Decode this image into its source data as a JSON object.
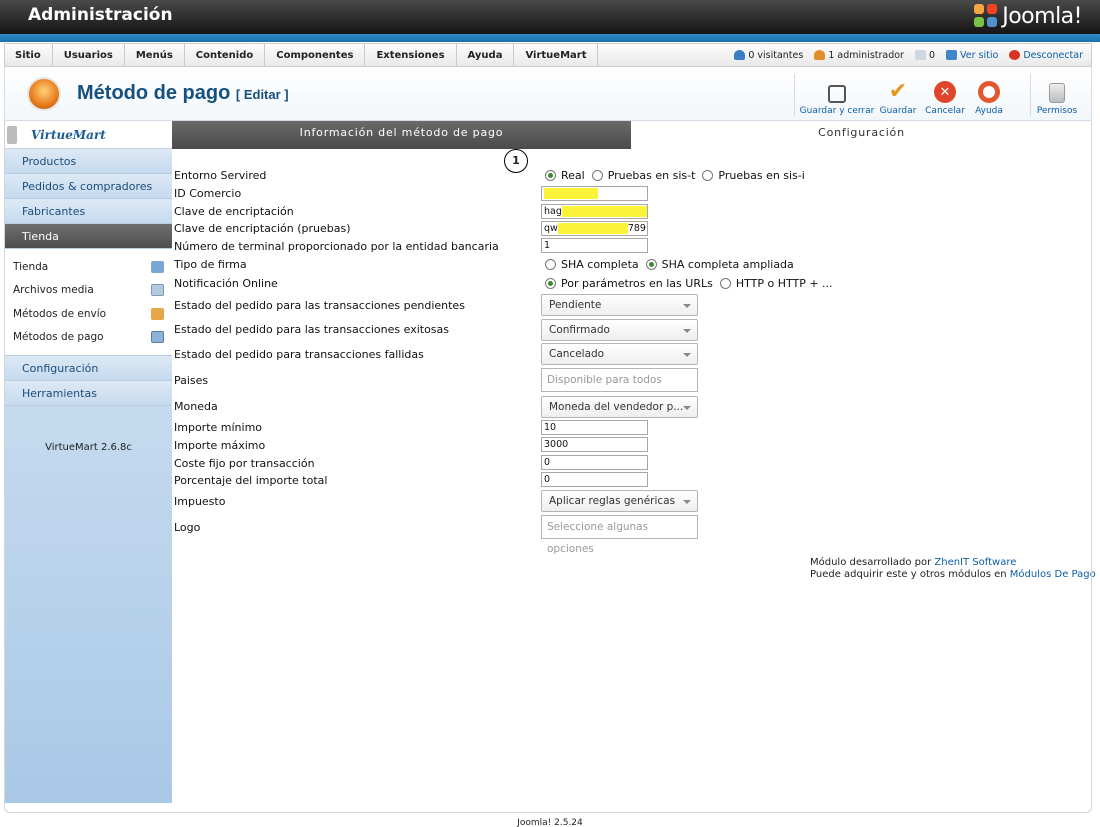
{
  "app": {
    "title": "Administración",
    "brand": "Joomla!"
  },
  "menu": {
    "items": [
      "Sitio",
      "Usuarios",
      "Menús",
      "Contenido",
      "Componentes",
      "Extensiones",
      "Ayuda",
      "VirtueMart"
    ],
    "status": {
      "visitors": "0 visitantes",
      "admins": "1 administrador",
      "messages": "0",
      "view_site": "Ver sitio",
      "logout": "Desconectar"
    }
  },
  "toolbar": {
    "heading": "Método de pago",
    "heading_suffix": "[ Editar ]",
    "buttons": {
      "save_close": "Guardar y cerrar",
      "save": "Guardar",
      "cancel": "Cancelar",
      "help": "Ayuda",
      "permissions": "Permisos"
    }
  },
  "sidebar": {
    "logo": "VirtueMart",
    "items": [
      "Productos",
      "Pedidos & compradores",
      "Fabricantes",
      "Tienda"
    ],
    "active_item": "Tienda",
    "sub_items": [
      "Tienda",
      "Archivos media",
      "Métodos de envío",
      "Métodos de pago"
    ],
    "items_bottom": [
      "Configuración",
      "Herramientas"
    ],
    "version": "VirtueMart 2.6.8c"
  },
  "tabs": {
    "info": "Información del método de pago",
    "config": "Configuración"
  },
  "callout": "1",
  "form": {
    "entorno": {
      "label": "Entorno Servired",
      "options": [
        "Real",
        "Pruebas en sis-t",
        "Pruebas en sis-i"
      ],
      "selected": "Real"
    },
    "id_comercio": {
      "label": "ID Comercio",
      "value": ""
    },
    "clave": {
      "label": "Clave de encriptación",
      "value_start": "hag",
      "value_end": "q"
    },
    "clave_pruebas": {
      "label": "Clave de encriptación (pruebas)",
      "value_start": "qw",
      "value_end": "789"
    },
    "terminal": {
      "label": "Número de terminal proporcionado por la entidad bancaria",
      "value": "1"
    },
    "tipo_firma": {
      "label": "Tipo de firma",
      "options": [
        "SHA completa",
        "SHA completa ampliada"
      ],
      "selected": "SHA completa ampliada"
    },
    "notificacion": {
      "label": "Notificación Online",
      "options": [
        "Por parámetros en las URLs",
        "HTTP o HTTP + ..."
      ],
      "selected": "Por parámetros en las URLs"
    },
    "estado_pendientes": {
      "label": "Estado del pedido para las transacciones pendientes",
      "value": "Pendiente"
    },
    "estado_exitosas": {
      "label": "Estado del pedido para las transacciones exitosas",
      "value": "Confirmado"
    },
    "estado_fallidas": {
      "label": "Estado del pedido para transacciones fallidas",
      "value": "Cancelado"
    },
    "paises": {
      "label": "Paises",
      "placeholder": "Disponible para todos"
    },
    "moneda": {
      "label": "Moneda",
      "value": "Moneda del vendedor p..."
    },
    "importe_min": {
      "label": "Importe mínimo",
      "value": "10"
    },
    "importe_max": {
      "label": "Importe máximo",
      "value": "3000"
    },
    "coste_fijo": {
      "label": "Coste fijo por transacción",
      "value": "0"
    },
    "porcentaje": {
      "label": "Porcentaje del importe total",
      "value": "0"
    },
    "impuesto": {
      "label": "Impuesto",
      "value": "Aplicar reglas genéricas"
    },
    "logo": {
      "label": "Logo",
      "placeholder": "Seleccione algunas opciones"
    }
  },
  "credits": {
    "line1": "Módulo desarrollado por ",
    "link1": "ZhenIT Software",
    "line2": "Puede adquirir este y otros módulos en ",
    "link2": "Módulos De Pago"
  },
  "footer": "Joomla! 2.5.24",
  "colors": {
    "accent": "#15507e",
    "stripe": "#2e8dc7",
    "active_tab": "#555555"
  }
}
